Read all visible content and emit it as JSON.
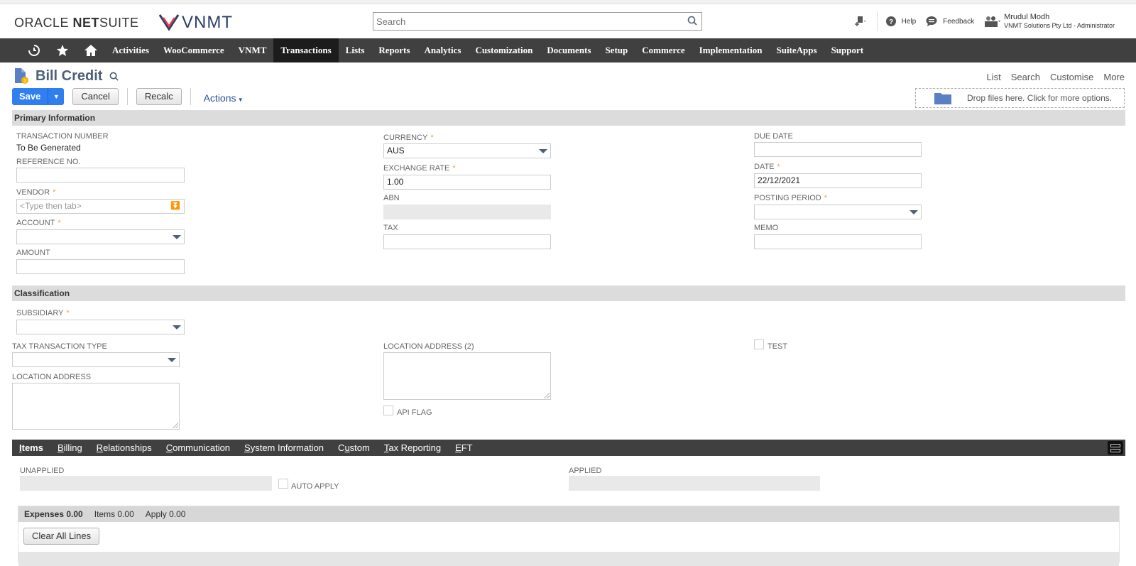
{
  "header": {
    "brand": {
      "oracle": "ORACLE",
      "netsuite_bold": "NET",
      "netsuite_rest": "SUITE",
      "company_logo": "VNMT"
    },
    "search": {
      "placeholder": "Search"
    },
    "help_label": "Help",
    "feedback_label": "Feedback",
    "user": {
      "name": "Mrudul Modh",
      "role": "VNMT Solutions Pty Ltd - Administrator"
    }
  },
  "nav": {
    "items": [
      "Activities",
      "WooCommerce",
      "VNMT",
      "Transactions",
      "Lists",
      "Reports",
      "Analytics",
      "Customization",
      "Documents",
      "Setup",
      "Commerce",
      "Implementation",
      "SuiteApps",
      "Support"
    ],
    "active": "Transactions"
  },
  "page": {
    "title": "Bill Credit",
    "top_links": [
      "List",
      "Search",
      "Customise",
      "More"
    ],
    "buttons": {
      "save": "Save",
      "cancel": "Cancel",
      "recalc": "Recalc",
      "actions": "Actions"
    },
    "drop_files": "Drop files here. Click for more options."
  },
  "primary": {
    "section_title": "Primary Information",
    "transaction_number_label": "TRANSACTION NUMBER",
    "transaction_number_value": "To Be Generated",
    "reference_label": "REFERENCE NO.",
    "reference_value": "",
    "vendor_label": "VENDOR",
    "vendor_placeholder": "<Type then tab>",
    "account_label": "ACCOUNT",
    "account_value": "",
    "amount_label": "AMOUNT",
    "amount_value": "",
    "currency_label": "CURRENCY",
    "currency_value": "AUS",
    "exchange_rate_label": "EXCHANGE RATE",
    "exchange_rate_value": "1.00",
    "abn_label": "ABN",
    "abn_value": "",
    "tax_label": "TAX",
    "tax_value": "",
    "due_date_label": "DUE DATE",
    "due_date_value": "",
    "date_label": "DATE",
    "date_value": "22/12/2021",
    "posting_period_label": "POSTING PERIOD",
    "posting_period_value": "",
    "memo_label": "MEMO",
    "memo_value": ""
  },
  "classification": {
    "section_title": "Classification",
    "subsidiary_label": "SUBSIDIARY",
    "tax_transaction_type_label": "TAX TRANSACTION TYPE",
    "location_address_label": "LOCATION ADDRESS",
    "location_address2_label": "LOCATION ADDRESS (2)",
    "api_flag_label": "API FLAG",
    "test_label": "TEST"
  },
  "subtabs": [
    {
      "label": "Items",
      "u": "I",
      "rest": "tems",
      "active": true
    },
    {
      "label": "Billing",
      "u": "B",
      "rest": "illing"
    },
    {
      "label": "Relationships",
      "u": "R",
      "rest": "elationships"
    },
    {
      "label": "Communication",
      "u": "C",
      "rest": "ommunication"
    },
    {
      "label": "System Information",
      "u": "S",
      "rest": "ystem Information"
    },
    {
      "label": "Custom",
      "pre": "C",
      "u": "u",
      "rest": "stom"
    },
    {
      "label": "Tax Reporting",
      "u": "T",
      "rest": "ax Reporting"
    },
    {
      "label": "EFT",
      "u": "E",
      "rest": "FT"
    }
  ],
  "items_tab": {
    "unapplied_label": "UNAPPLIED",
    "auto_apply_label": "AUTO APPLY",
    "applied_label": "APPLIED",
    "line_tabs": [
      {
        "label": "Expenses 0.00",
        "active": true
      },
      {
        "label": "Items 0.00"
      },
      {
        "label": "Apply 0.00"
      }
    ],
    "clear_all_lines": "Clear All Lines"
  },
  "required_marker": "*"
}
